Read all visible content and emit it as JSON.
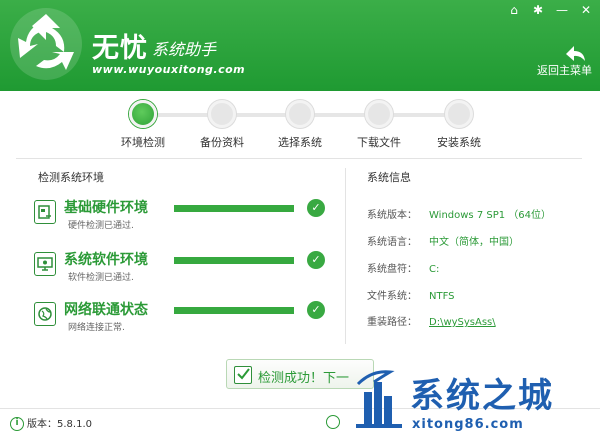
{
  "app": {
    "title": "无忧",
    "subtitle": "系统助手",
    "url": "www.wuyouxitong.com",
    "back_label": "返回主菜单"
  },
  "top_controls": [
    {
      "icon": "home-icon",
      "glyph": "⌂"
    },
    {
      "icon": "gear-icon",
      "glyph": "✱"
    },
    {
      "icon": "minimize-icon",
      "glyph": "—"
    },
    {
      "icon": "close-icon",
      "glyph": "✕"
    }
  ],
  "steps": [
    {
      "label": "环境检测",
      "active": true
    },
    {
      "label": "备份资料",
      "active": false
    },
    {
      "label": "选择系统",
      "active": false
    },
    {
      "label": "下载文件",
      "active": false
    },
    {
      "label": "安装系统",
      "active": false
    }
  ],
  "left_panel": {
    "title": "检测系统环境",
    "checks": [
      {
        "name": "基础硬件环境",
        "desc": "硬件检测已通过.",
        "progress": 1.0,
        "status": "ok"
      },
      {
        "name": "系统软件环境",
        "desc": "软件检测已通过.",
        "progress": 1.0,
        "status": "ok"
      },
      {
        "name": "网络联通状态",
        "desc": "网络连接正常.",
        "progress": 1.0,
        "status": "ok"
      }
    ]
  },
  "right_panel": {
    "title": "系统信息",
    "rows": [
      {
        "key": "系统版本：",
        "value": "Windows 7 SP1 （64位）"
      },
      {
        "key": "系统语言：",
        "value": "中文（简体，中国）"
      },
      {
        "key": "系统盘符：",
        "value": "C:"
      },
      {
        "key": "文件系统：",
        "value": "NTFS"
      },
      {
        "key": "重装路径：",
        "value": "D:\\wySysAss\\"
      }
    ]
  },
  "next_button": {
    "label": "检测成功！下一"
  },
  "footer": {
    "version": "版本：5.8.1.0"
  },
  "watermark": {
    "title": "系统之城",
    "url": "xitong86.com"
  },
  "colors": {
    "brand_green": "#2b9a37",
    "header_green": "#1f9a32",
    "watermark_blue": "#1f5fb0"
  }
}
